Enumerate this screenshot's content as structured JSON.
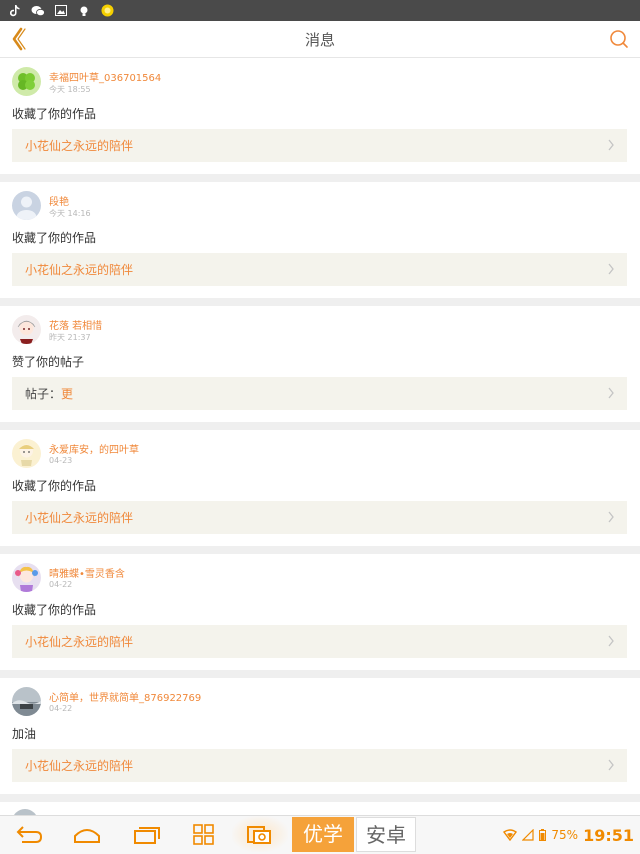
{
  "status_bar": {
    "icons": [
      "tiktok-icon",
      "wechat-icon",
      "image-icon",
      "bulb-icon",
      "coin-icon"
    ]
  },
  "header": {
    "title": "消息",
    "back_icon": "chevron-left-icon",
    "search_icon": "search-icon"
  },
  "colors": {
    "accent": "#f0883a",
    "ref_bg": "#f4f3ec",
    "separator": "#efefef"
  },
  "notifications": [
    {
      "user": "幸福四叶草_036701564",
      "time": "今天 18:55",
      "action": "收藏了你的作品",
      "ref_prefix": "",
      "ref_text": "小花仙之永远的陪伴"
    },
    {
      "user": "段艳",
      "time": "今天 14:16",
      "action": "收藏了你的作品",
      "ref_prefix": "",
      "ref_text": "小花仙之永远的陪伴"
    },
    {
      "user": "花落 若相惜",
      "time": "昨天 21:37",
      "action": "赞了你的帖子",
      "ref_prefix": "帖子：",
      "ref_text": "更"
    },
    {
      "user": "永爱库安，的四叶草",
      "time": "04-23",
      "action": "收藏了你的作品",
      "ref_prefix": "",
      "ref_text": "小花仙之永远的陪伴"
    },
    {
      "user": "晴雅蝶•雪灵香含",
      "time": "04-22",
      "action": "收藏了你的作品",
      "ref_prefix": "",
      "ref_text": "小花仙之永远的陪伴"
    },
    {
      "user": "心简单，世界就简单_876922769",
      "time": "04-22",
      "action": "加油",
      "ref_prefix": "",
      "ref_text": "小花仙之永远的陪伴"
    }
  ],
  "bottom_bar": {
    "tab_youxue": "优学",
    "tab_anzhuo": "安卓",
    "battery": "75%",
    "clock": "19:51"
  }
}
